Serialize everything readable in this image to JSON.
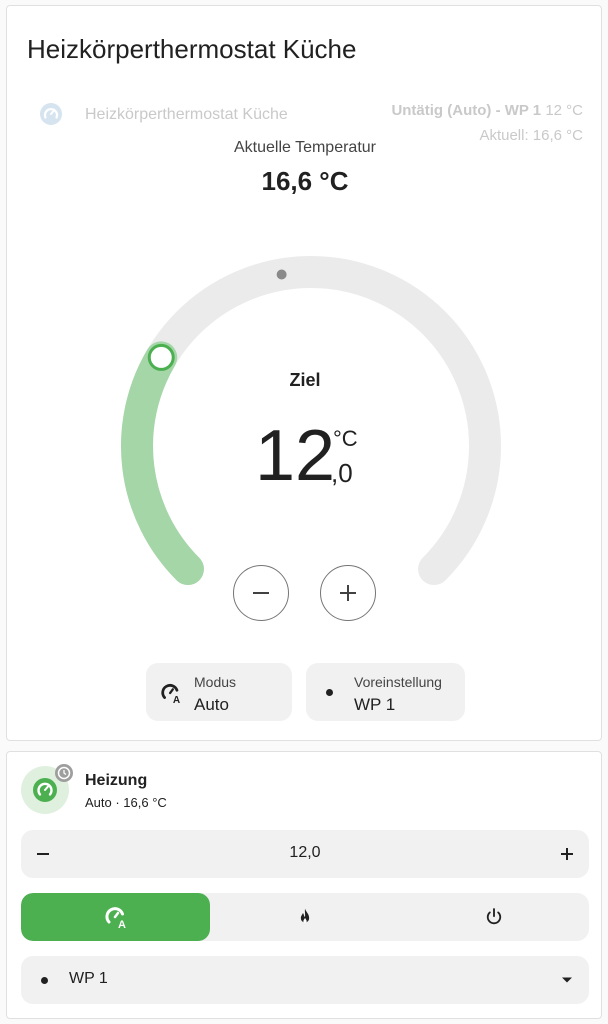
{
  "colors": {
    "accent": "#4caf50",
    "accent_light": "#a5d6a7",
    "track": "#ebebeb",
    "ghost": "#c9c9c9"
  },
  "thermostat_card": {
    "title": "Heizkörperthermostat Küche",
    "overlay": {
      "name": "Heizkörperthermostat Küche",
      "status": "Untätig (Auto) - WP 1",
      "target": "12 °C",
      "current": "Aktuell: 16,6 °C"
    },
    "current_label": "Aktuelle Temperatur",
    "current_value": "16,6 °C",
    "dial": {
      "min": 5,
      "max": 30,
      "target": 12.0,
      "current": 16.6
    },
    "target_label": "Ziel",
    "target_integer": "12",
    "target_decimal": ",0",
    "target_unit": "°C",
    "mode_chip": {
      "title": "Modus",
      "value": "Auto",
      "icon": "thermostat-auto-icon"
    },
    "preset_chip": {
      "title": "Voreinstellung",
      "value": "WP 1"
    }
  },
  "entity_card": {
    "name": "Heizung",
    "state": "Auto · 16,6 °C",
    "target_value": "12,0",
    "modes": [
      {
        "icon": "thermostat-auto-icon",
        "active": true
      },
      {
        "icon": "fire-icon",
        "active": false
      },
      {
        "icon": "power-icon",
        "active": false
      }
    ],
    "preset_value": "WP 1"
  }
}
